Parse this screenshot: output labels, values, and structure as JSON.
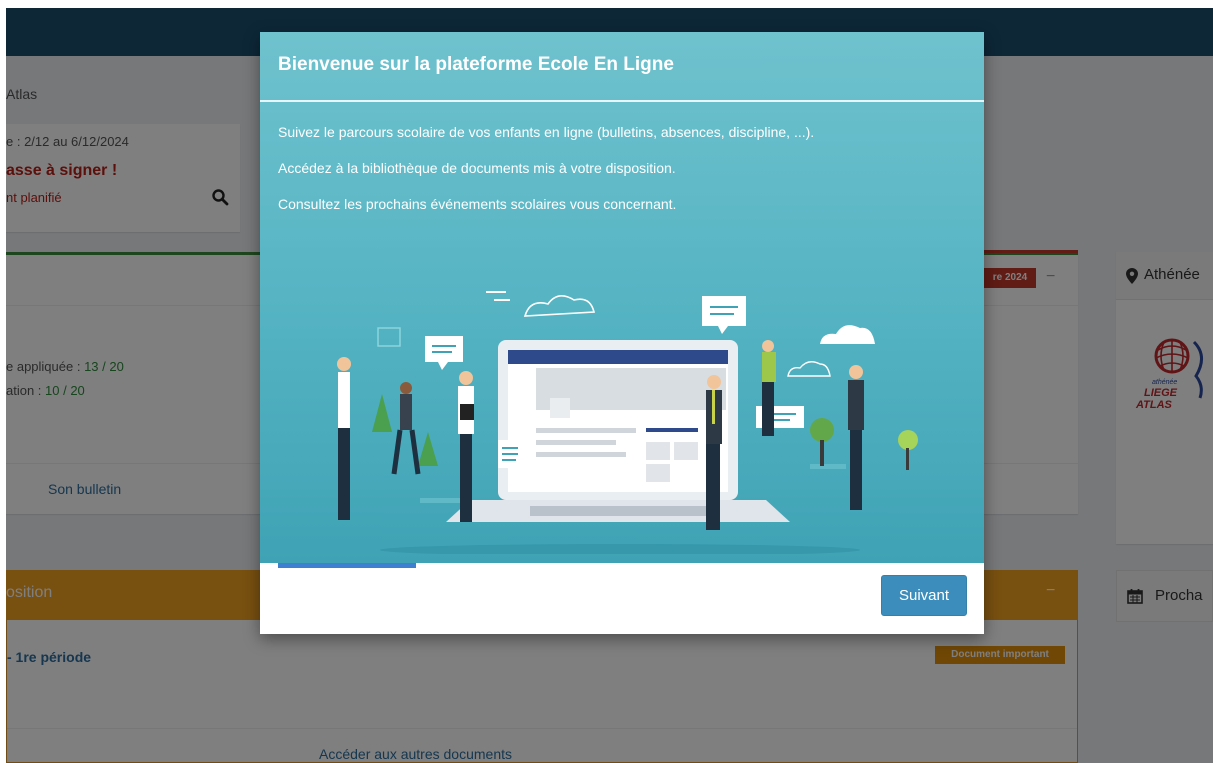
{
  "background": {
    "breadcrumb": "Atlas",
    "week": "e : 2/12 au 6/12/2024",
    "sign_alert": "asse à signer !",
    "planned": "nt planifié",
    "grades": {
      "applied_label": "e appliquée : ",
      "applied_value": "13 / 20",
      "other_label": "ation : ",
      "other_value": "10 / 20",
      "bulletin_link": "Son bulletin",
      "badge": "re 2024"
    },
    "school": {
      "title": "Athénée",
      "logo_text": "LIEGE ATLAS"
    },
    "documents": {
      "header": "osition",
      "doc_title": "- 1re période",
      "important_badge": "Document important",
      "other_link": "Accéder aux autres documents"
    },
    "events": {
      "title": "Procha"
    },
    "colors": {
      "topbar": "#1a4e6e",
      "grades_border": "#3c8d3c",
      "docs_header": "#f0a021",
      "alert": "#b82018"
    }
  },
  "modal": {
    "title": "Bienvenue sur la plateforme Ecole En Ligne",
    "lines": [
      "Suivez le parcours scolaire de vos enfants en ligne (bulletins, absences, discipline, ...).",
      "Accédez à la bibliothèque de documents mis à votre disposition.",
      "Consultez les prochains événements scolaires vous concernant."
    ],
    "next_button": "Suivant",
    "step_progress": 0.19,
    "colors": {
      "hero_top": "#6fc2ce",
      "hero_bottom": "#3fa3b5",
      "progress": "#3d7fd1",
      "button": "#3c8dbc"
    }
  }
}
